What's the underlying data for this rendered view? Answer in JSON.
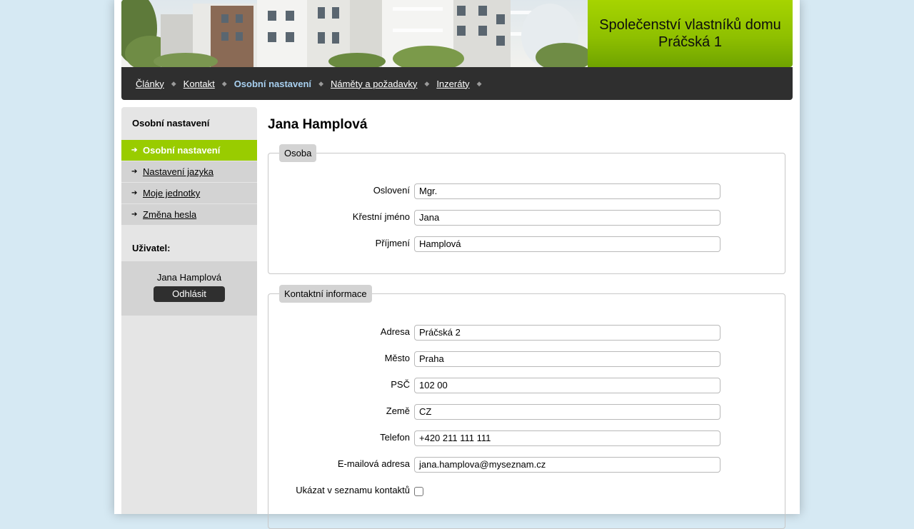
{
  "header": {
    "site_title": "Společenství vlastníků domu Práčská 1"
  },
  "nav": {
    "items": [
      {
        "label": "Články",
        "active": false
      },
      {
        "label": "Kontakt",
        "active": false
      },
      {
        "label": "Osobní nastavení",
        "active": true
      },
      {
        "label": "Náměty a požadavky",
        "active": false
      },
      {
        "label": "Inzeráty",
        "active": false
      }
    ],
    "separator_icon": "diamond-separator-icon"
  },
  "sidebar": {
    "heading": "Osobní nastavení",
    "items": [
      {
        "label": "Osobní nastavení",
        "active": true
      },
      {
        "label": "Nastavení jazyka",
        "active": false
      },
      {
        "label": "Moje jednotky",
        "active": false
      },
      {
        "label": "Změna hesla",
        "active": false
      }
    ],
    "user_heading": "Uživatel:",
    "user_name": "Jana Hamplová",
    "logout_label": "Odhlásit"
  },
  "main": {
    "title": "Jana Hamplová",
    "person": {
      "legend": "Osoba",
      "fields": [
        {
          "label": "Oslovení",
          "value": "Mgr."
        },
        {
          "label": "Křestní jméno",
          "value": "Jana"
        },
        {
          "label": "Příjmení",
          "value": "Hamplová"
        }
      ]
    },
    "contact": {
      "legend": "Kontaktní informace",
      "fields": [
        {
          "label": "Adresa",
          "value": "Práčská 2"
        },
        {
          "label": "Město",
          "value": "Praha"
        },
        {
          "label": "PSČ",
          "value": "102 00"
        },
        {
          "label": "Země",
          "value": "CZ"
        },
        {
          "label": "Telefon",
          "value": "+420 211 111 111"
        },
        {
          "label": "E-mailová adresa",
          "value": "jana.hamplova@myseznam.cz"
        }
      ],
      "show_in_contacts": {
        "label": "Ukázat v seznamu kontaktů",
        "checked": false
      }
    }
  },
  "colors": {
    "accent_green": "#99cc00",
    "nav_dark": "#2f2f2f",
    "nav_active": "#a8d0f0",
    "background": "#d6e9f3"
  }
}
